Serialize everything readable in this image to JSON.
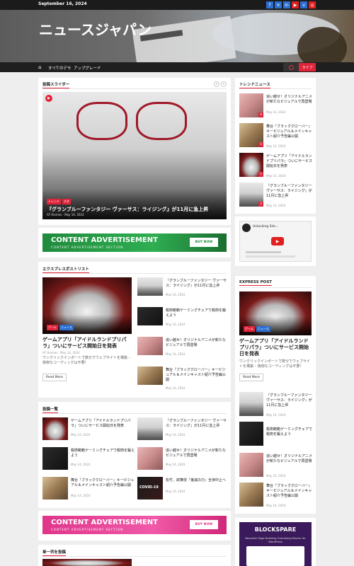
{
  "topbar": {
    "date": "September 16, 2024",
    "social_icons": [
      "facebook-icon",
      "x-icon",
      "linkedin-icon",
      "youtube-icon",
      "vimeo-icon",
      "instagram-icon"
    ]
  },
  "site": {
    "title": "ニュースジャパン"
  },
  "nav": {
    "items": [
      "すべてのデモ",
      "アップグレード"
    ],
    "live": "ライブ"
  },
  "slider": {
    "heading": "投稿スライダー",
    "tags": [
      "トレンド",
      "ネタ"
    ],
    "title": "『グランブルーファンタジー ヴァーサス：ライジング』が11月に急上昇",
    "author": "AF themes",
    "date": "May 14, 2024"
  },
  "ad1": {
    "headline": "CONTENT ADVERTISEMENT",
    "sub": "CONTENT ADVERTISEMENT SECTION",
    "button": "BUY NOW",
    "color": "#22a04a"
  },
  "express": {
    "heading": "エクスプレスポストリスト",
    "main": {
      "tags": [
        "ゲーム",
        "ニュース"
      ],
      "title": "ゲームアプリ「アイドルランドプリパラ」ついにサービス開始日を発表",
      "author": "AF themes",
      "date": "May 14, 2024",
      "excerpt": "ワンクリックインポートで数分でウェブサイトを構築 – 偽物なコーディングは不要!",
      "readmore": "Read More"
    },
    "side": [
      {
        "title": "『グランブルーファンタジー ヴァーサス：ライジング』が11月に急上昇",
        "date": "May 14, 2024"
      },
      {
        "title": "税術範範ゲーミングチェアで税術を鍛えよう",
        "date": "May 14, 2024"
      },
      {
        "title": "追い越せ！オリジナルアニメが新たなビジュアルで再登場",
        "date": "May 14, 2024"
      },
      {
        "title": "舞台『ブラッククローバー』キービジュアル＆メインキャスト紹介予告編公開",
        "date": "May 14, 2024"
      }
    ]
  },
  "postlist": {
    "heading": "投稿一覧",
    "items": [
      {
        "title": "ゲームアプリ「アイドルランドプリパラ」ついにサービス開始日を発表",
        "date": "May 14, 2024"
      },
      {
        "title": "『グランブルーファンタジー ヴァーサス：ライジング』が11月に急上昇",
        "date": "May 14, 2024"
      },
      {
        "title": "税術範範ゲーミングチェアで税術を鍛えよう",
        "date": "May 14, 2024"
      },
      {
        "title": "追い越せ！オリジナルアニメが新たなビジュアルで再登場",
        "date": "May 14, 2024"
      },
      {
        "title": "舞台『ブラッククローバー』キービジュアル＆メインキャスト紹介予告編公開",
        "date": "May 14, 2024"
      },
      {
        "title": "松竹、欲舞伎『鬼滅の刃』全演中止へ",
        "date": "May 14, 2024"
      }
    ],
    "covid_label": "COVID-19"
  },
  "ad2": {
    "headline": "CONTENT ADVERTISEMENT",
    "sub": "CONTENT ADVERTISEMENT SECTION",
    "button": "BUY NOW",
    "color": "#e0358a"
  },
  "single": {
    "heading": "単一列を投稿"
  },
  "trending": {
    "heading": "トレンドニュース",
    "items": [
      {
        "num": "4",
        "title": "追い越せ！オリジナルアニメが新たなビジュアルで再登場",
        "date": "May 14, 2024"
      },
      {
        "num": "5",
        "title": "舞台『ブラッククローバー』キービジュアル＆メインキャスト紹介予告編公開",
        "date": "May 14, 2024"
      },
      {
        "num": "1",
        "title": "ゲームアプリ「アイドルランドプリパラ」ついにサービス開始日を発表",
        "date": "May 14, 2024"
      },
      {
        "num": "2",
        "title": "『グランブルーファンタジー ヴァーサス：ライジング』が11月に急上昇",
        "date": "May 14, 2024"
      }
    ]
  },
  "video": {
    "channel": "Unlocking Sim..."
  },
  "expresspost": {
    "heading": "EXPRESS POST",
    "main": {
      "tags": [
        "ゲーム",
        "ニュース"
      ],
      "title": "ゲームアプリ「アイドルランドプリパラ」ついにサービス開始日を発表",
      "excerpt": "ワンクリックインポートで数分でウェブサイトを構築 – 偽物なコーディングは不要!",
      "readmore": "Read More"
    },
    "items": [
      {
        "title": "『グランブルーファンタジー ヴァーサス：ライジング』が11月に急上昇",
        "date": "May 14, 2024"
      },
      {
        "title": "税術範範ゲーミングチェアで税術を鍛えよう",
        "date": "May 14, 2024"
      },
      {
        "title": "追い越せ！オリジナルアニメが新たなビジュアルで再登場",
        "date": "May 14, 2024"
      },
      {
        "title": "舞台『ブラッククローバー』キービジュアル＆メインキャスト紹介予告編公開",
        "date": "May 14, 2024"
      }
    ]
  },
  "blockspare": {
    "title": "BLOCKSPARE",
    "sub": "Beautiful Page Building Gutenberg Blocks for WordPress"
  }
}
